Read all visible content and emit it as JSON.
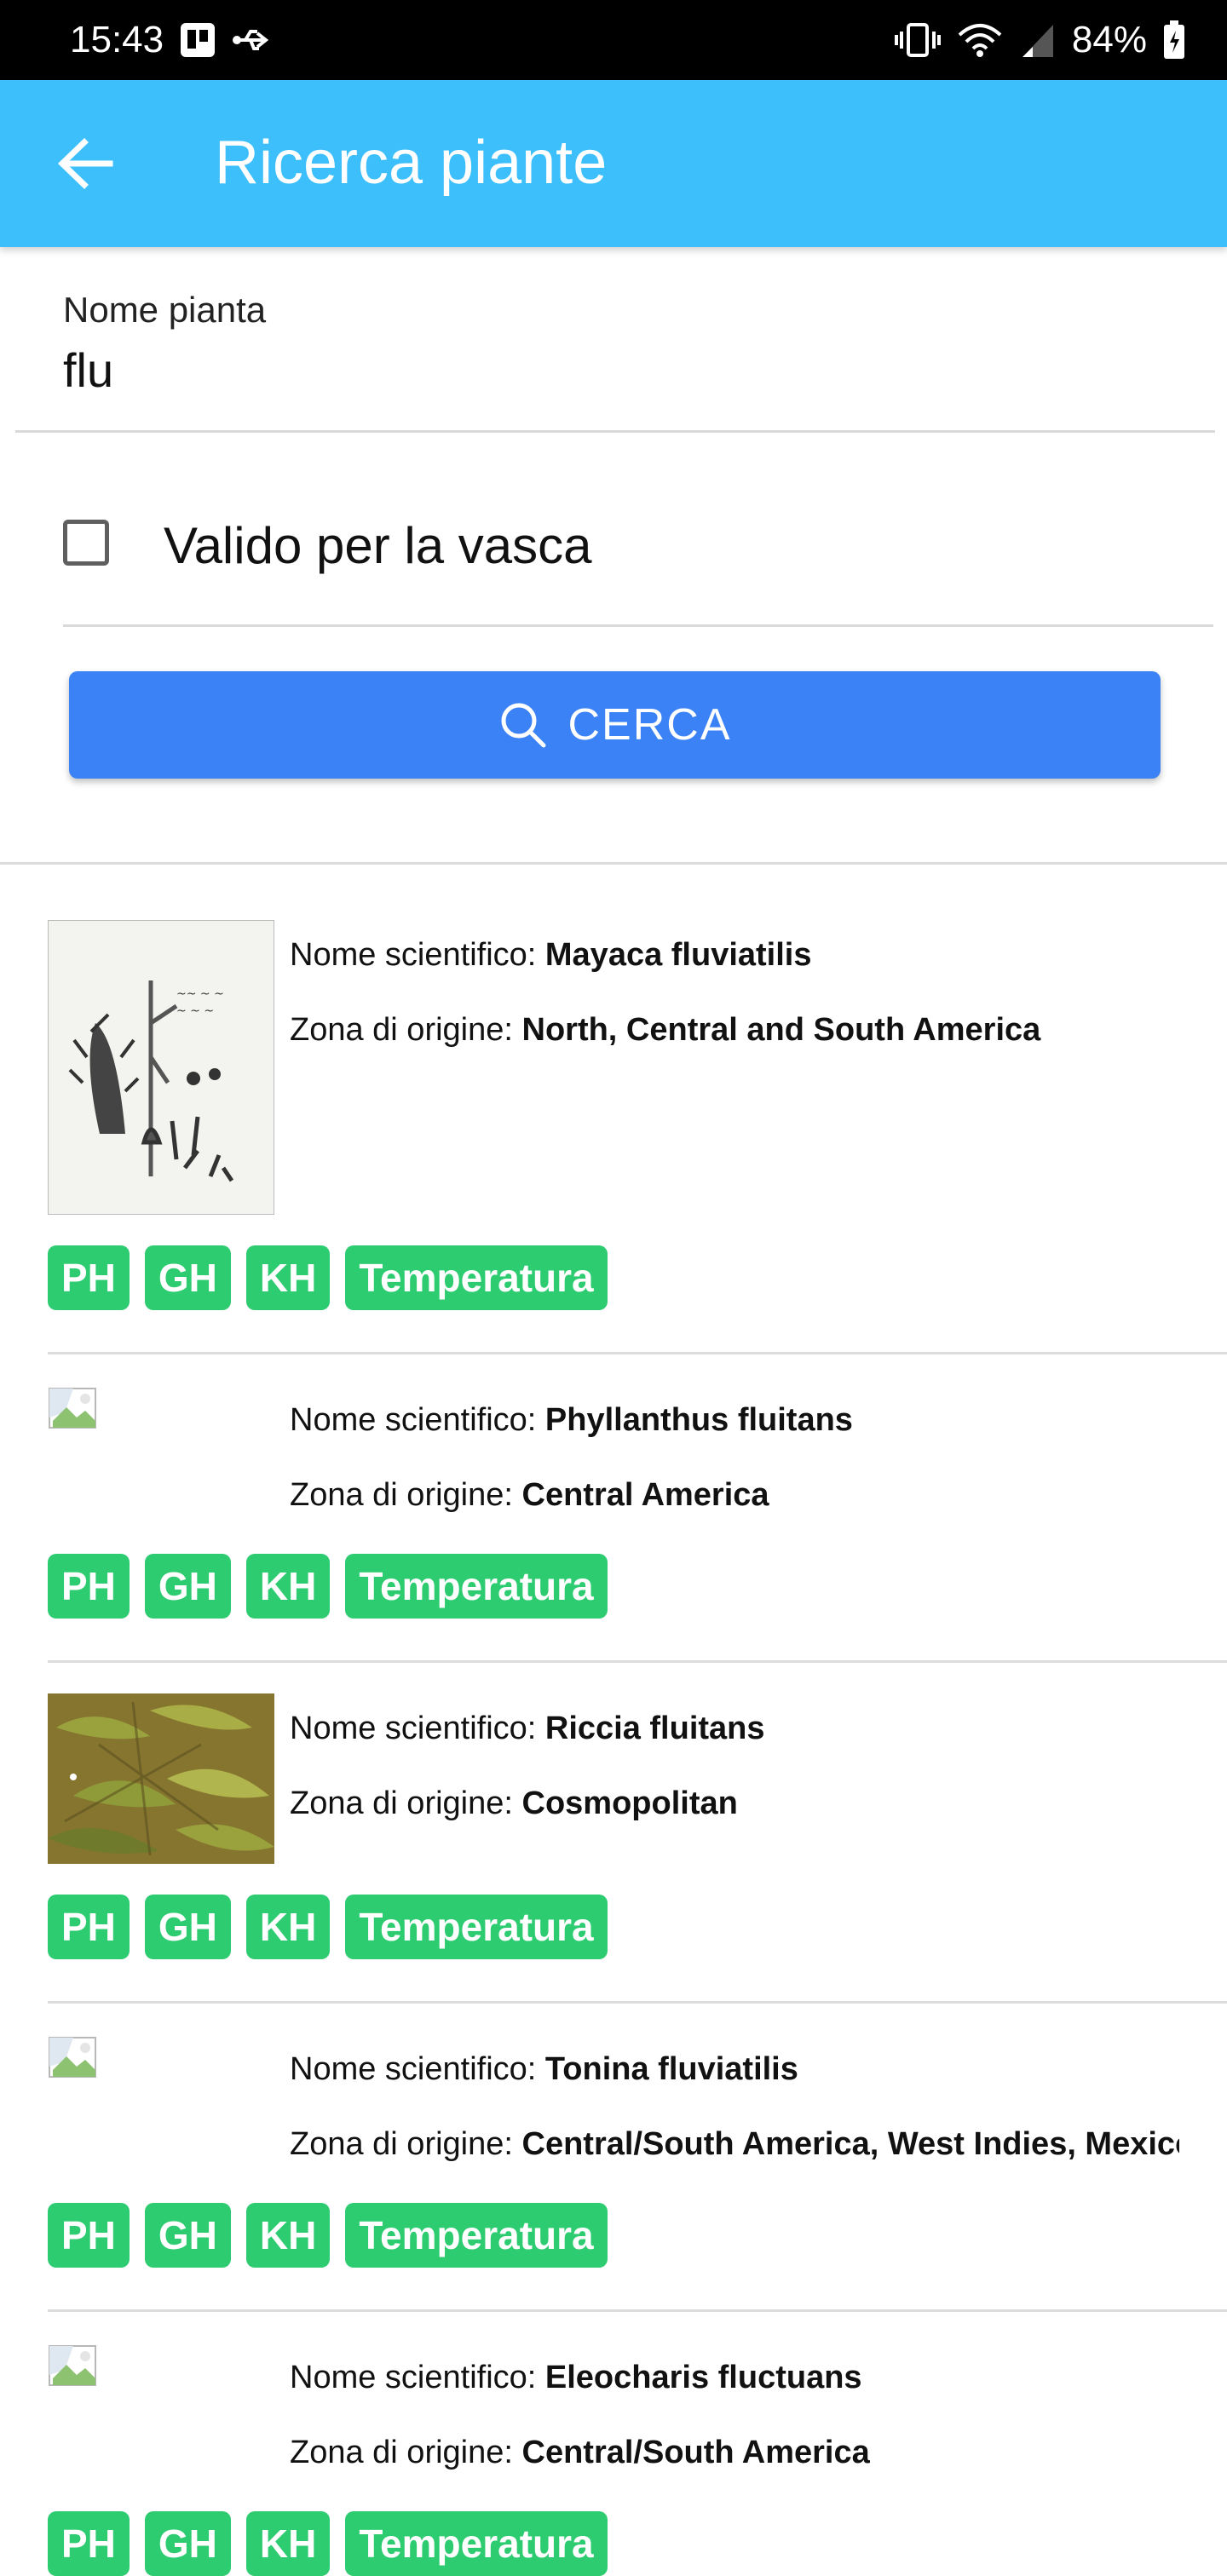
{
  "status_bar": {
    "time": "15:43",
    "battery": "84%",
    "icons": [
      "notification-icon",
      "usb-icon",
      "vibrate-icon",
      "wifi-icon",
      "signal-icon",
      "battery-icon"
    ]
  },
  "app_bar": {
    "title": "Ricerca piante",
    "back_icon": "arrow-left-icon",
    "background": "#3dbffb"
  },
  "search_form": {
    "name_label": "Nome pianta",
    "name_value": "flu",
    "checkbox_label": "Valido per la vasca",
    "checkbox_checked": false,
    "button_label": "CERCA",
    "button_icon": "search-icon",
    "button_color": "#3b82f6"
  },
  "labels": {
    "scientific": "Nome scientifico: ",
    "origin": "Zona di origine: "
  },
  "chip_color": "#2ecc71",
  "results": [
    {
      "scientific_name": "Mayaca fluviatilis",
      "origin": "North, Central and South America",
      "image": "botanical-illustration",
      "chips": [
        "PH",
        "GH",
        "KH",
        "Temperatura"
      ]
    },
    {
      "scientific_name": "Phyllanthus fluitans",
      "origin": "Central America",
      "image": "broken-image-icon",
      "chips": [
        "PH",
        "GH",
        "KH",
        "Temperatura"
      ]
    },
    {
      "scientific_name": "Riccia fluitans",
      "origin": "Cosmopolitan",
      "image": "plant-photo",
      "chips": [
        "PH",
        "GH",
        "KH",
        "Temperatura"
      ]
    },
    {
      "scientific_name": "Tonina fluviatilis",
      "origin": "Central/South America, West Indies, Mexico",
      "image": "broken-image-icon",
      "chips": [
        "PH",
        "GH",
        "KH",
        "Temperatura"
      ]
    },
    {
      "scientific_name": "Eleocharis fluctuans",
      "origin": "Central/South America",
      "image": "broken-image-icon",
      "chips": [
        "PH",
        "GH",
        "KH",
        "Temperatura"
      ]
    }
  ]
}
